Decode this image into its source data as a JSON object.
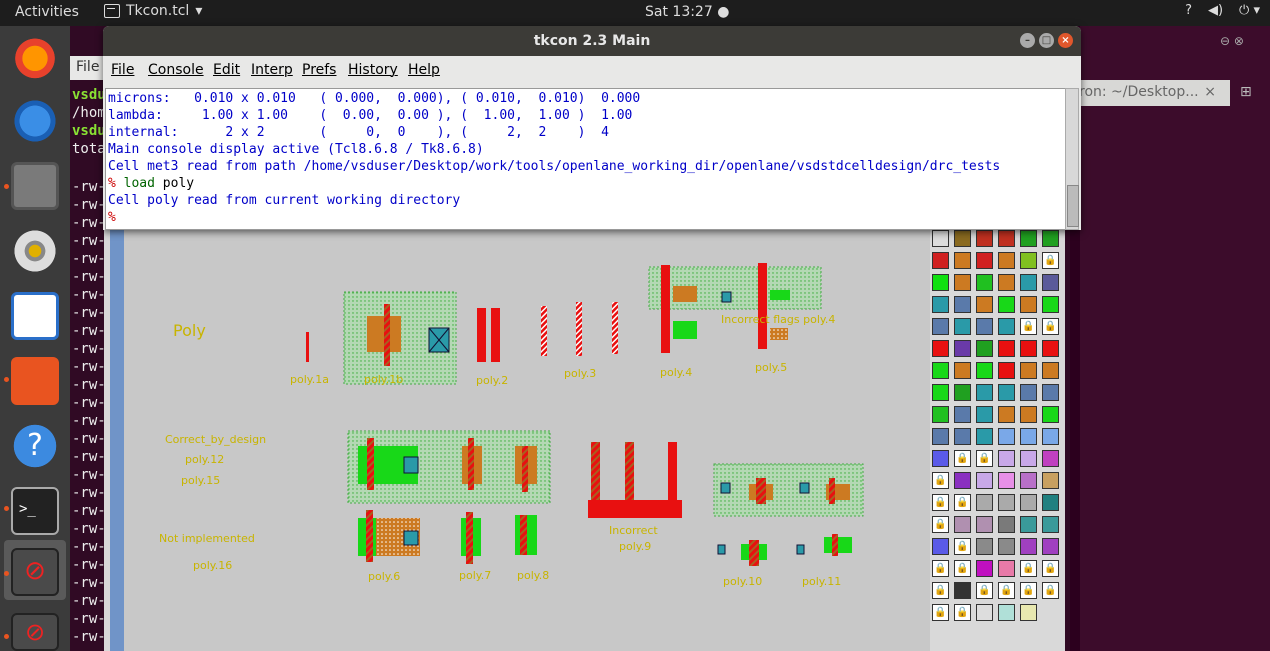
{
  "topbar": {
    "activities": "Activities",
    "app_name": "Tkcon.tcl",
    "app_caret": "▾",
    "clock": "Sat 13:27 ●",
    "tray": [
      "?",
      "◀)",
      "⏻ ▾"
    ]
  },
  "background_terminal": {
    "menu_file": "File",
    "lines": [
      "vsdu",
      "/hom",
      "vsdu",
      "tota",
      "-rw-",
      "-rw-",
      "-rw-",
      "-rw-",
      "-rw-",
      "-rw-",
      "-rw-",
      "-rw-",
      "-rw-",
      "-rw-",
      "-rw-",
      "-rw-",
      "-rw-",
      "-rw-",
      "-rw-",
      "-rw-",
      "-rw-",
      "-rw-",
      "-rw-",
      "-rw-",
      "-rw-",
      "-rw-",
      "-rw-",
      "-rw-",
      "-rw-",
      "-rw-",
      "-rw-",
      "-rw-",
      "-rw-"
    ],
    "right_tab": "ron: ~/Desktop...",
    "right_tab_close": "×"
  },
  "tkcon": {
    "title": "tkcon 2.3 Main",
    "menu": [
      "File",
      "Console",
      "Edit",
      "Interp",
      "Prefs",
      "History",
      "Help"
    ],
    "output": [
      {
        "text": "microns:   0.010 x 0.010   ( 0.000,  0.000), ( 0.010,  0.010)  0.000",
        "style": "blue"
      },
      {
        "text": "lambda:     1.00 x 1.00    (  0.00,  0.00 ), (  1.00,  1.00 )  1.00",
        "style": "blue"
      },
      {
        "text": "internal:      2 x 2       (     0,  0    ), (     2,  2    )  4",
        "style": "blue"
      },
      {
        "text": "Main console display active (Tcl8.6.8 / Tk8.6.8)",
        "style": "blue"
      },
      {
        "text": "Cell met3 read from path /home/vsduser/Desktop/work/tools/openlane_working_dir/openlane/vsdstdcelldesign/drc_tests",
        "style": "blue"
      }
    ],
    "prompt_char": "%",
    "command_keyword": "load",
    "command_arg": "poly",
    "after_output": "Cell poly read from current working directory",
    "final_prompt": "%"
  },
  "layout": {
    "labels": {
      "poly": "Poly",
      "correct_by_design": "Correct_by_design",
      "poly12": "poly.12",
      "poly15": "poly.15",
      "not_implemented": "Not implemented",
      "poly16": "poly.16",
      "poly1a": "poly.1a",
      "poly1b": "poly.1b",
      "poly2": "poly.2",
      "poly3": "poly.3",
      "poly4": "poly.4",
      "poly5": "poly.5",
      "incorrect_flags": "Incorrect flags poly.4",
      "poly6": "poly.6",
      "poly7": "poly.7",
      "poly8": "poly.8",
      "incorrect": "Incorrect",
      "poly9": "poly.9",
      "poly10": "poly.10",
      "poly11": "poly.11"
    }
  },
  "colors": {
    "poly_red": "#e81010",
    "diff_green": "#18d818",
    "orange": "#cc7a22",
    "label_yellow": "#c8b400",
    "contact_teal": "#2a9aa8"
  }
}
